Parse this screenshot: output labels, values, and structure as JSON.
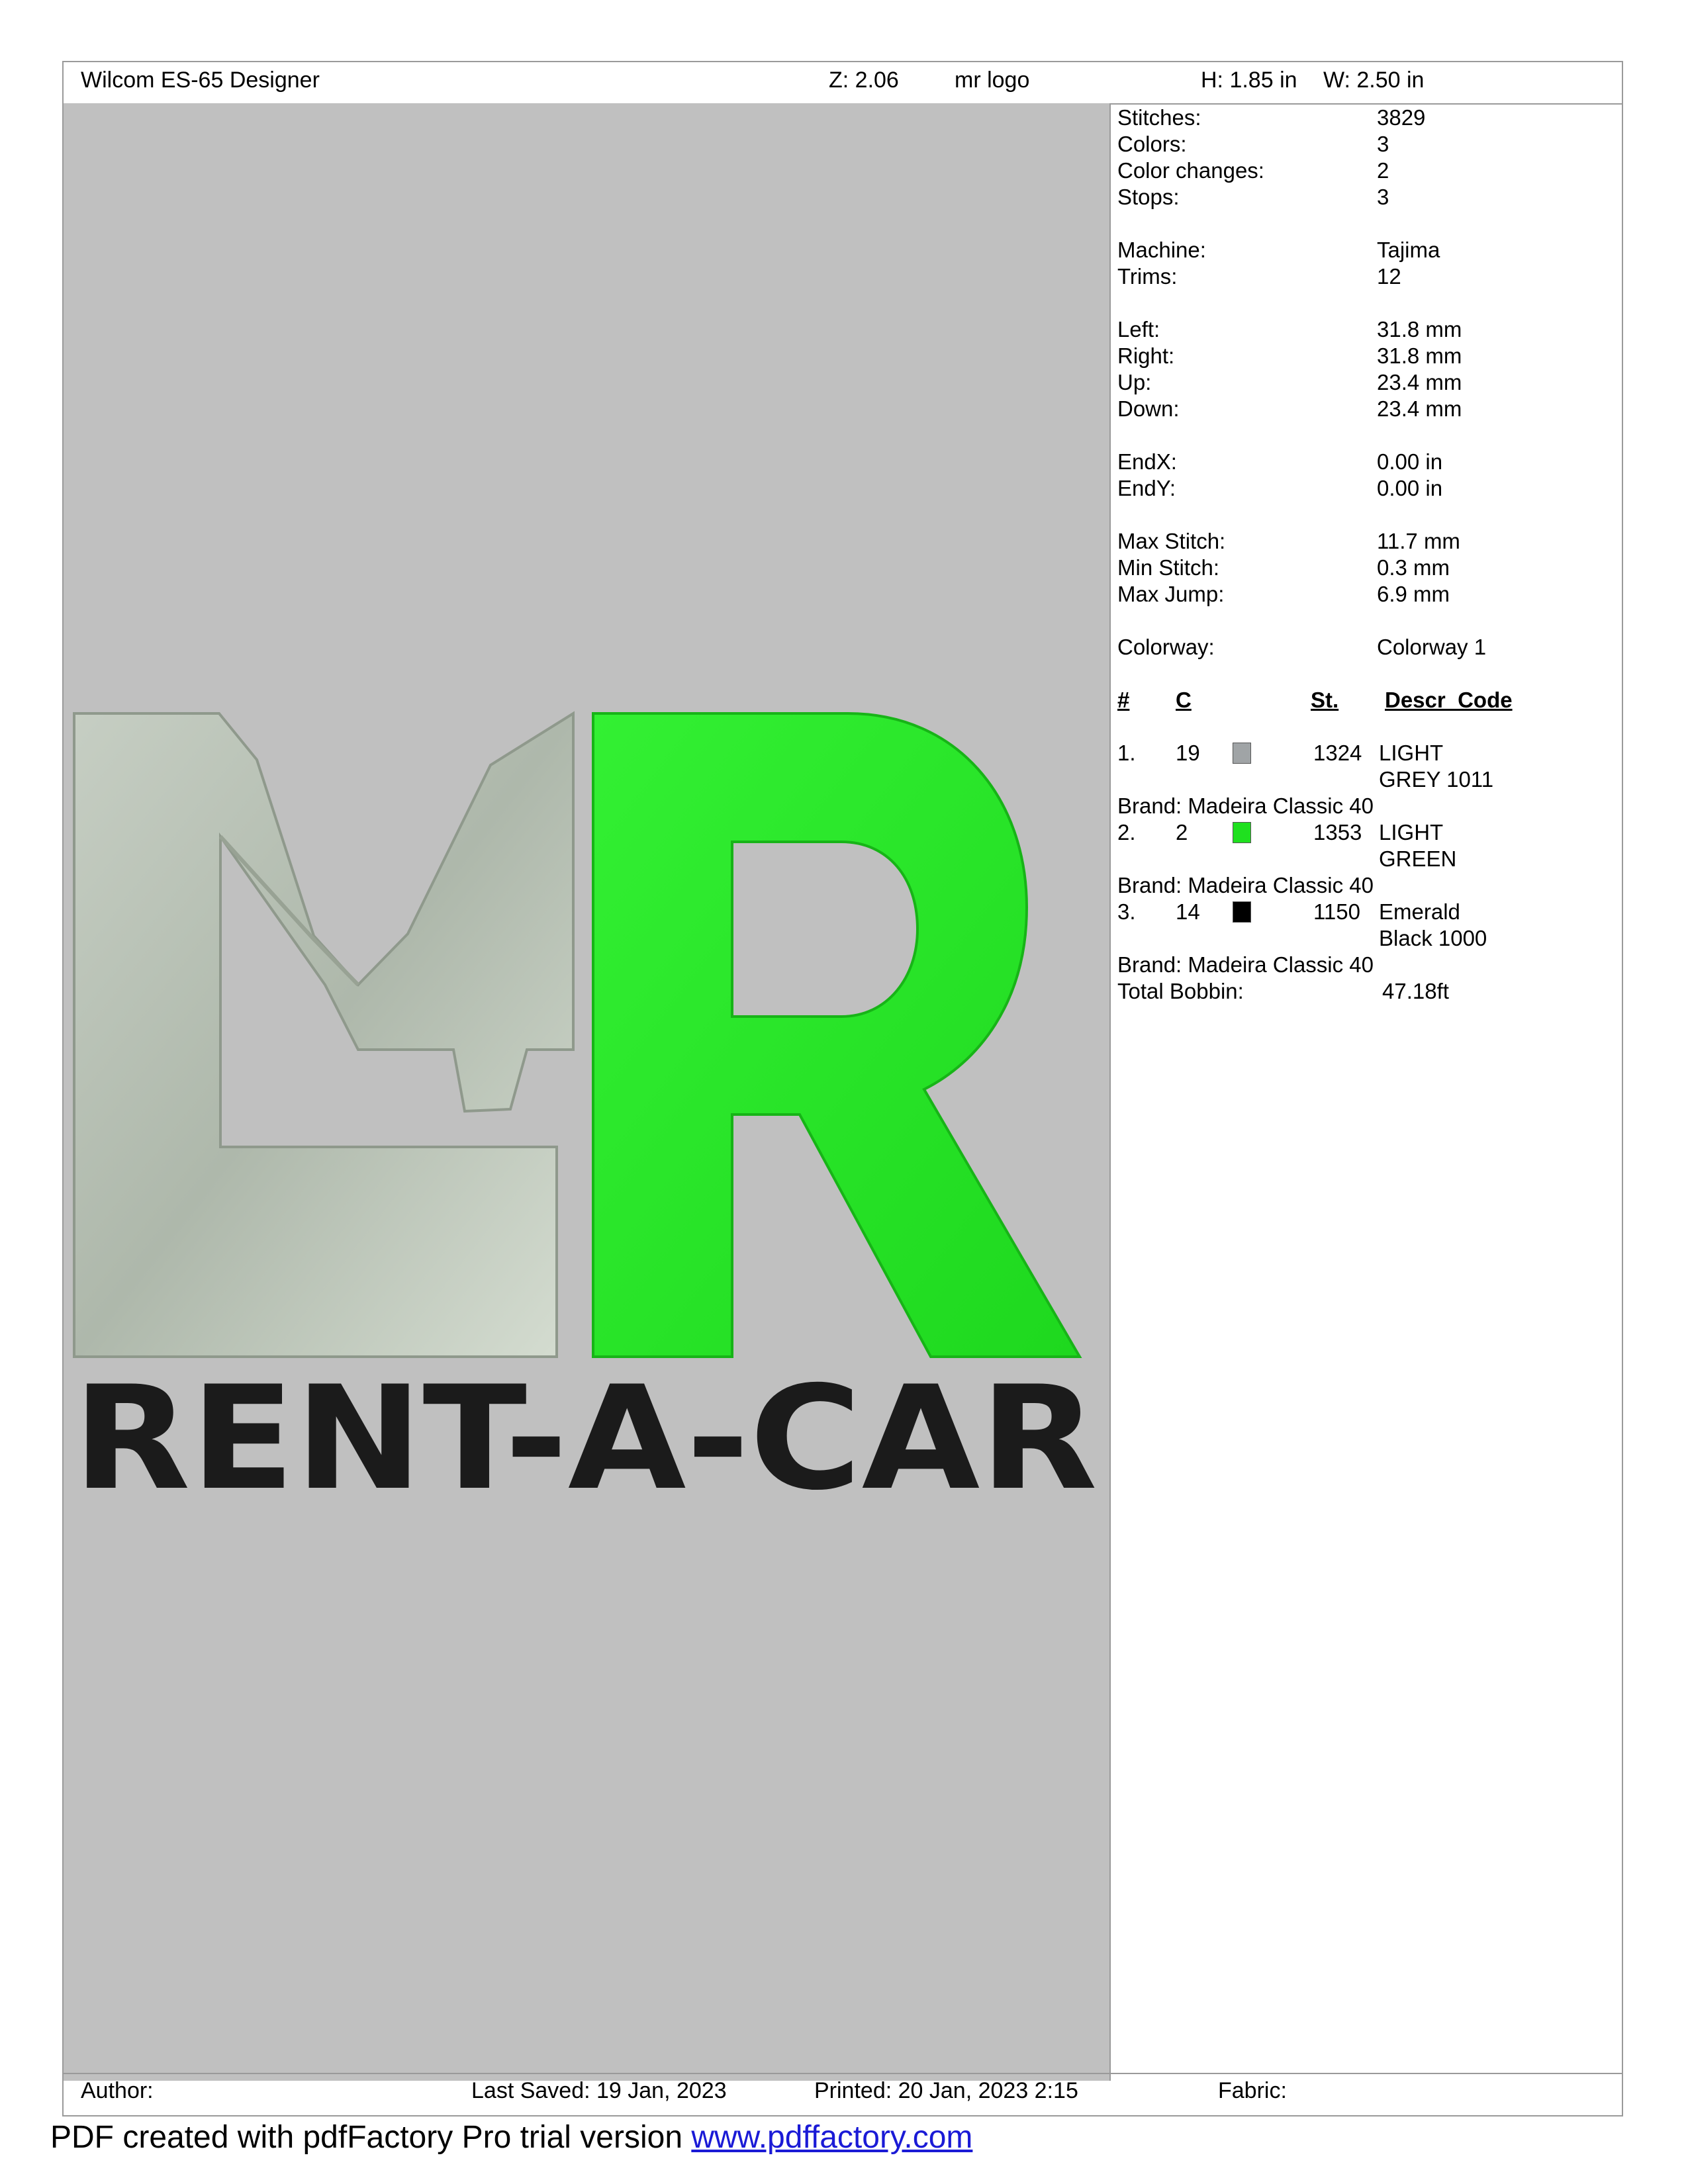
{
  "header": {
    "app": "Wilcom ES-65 Designer",
    "zoom": "Z: 2.06",
    "design_name": "mr logo",
    "height": "H: 1.85 in",
    "width": "W: 2.50 in"
  },
  "design": {
    "logo_bottom_text": "RENT-A-CAR",
    "colors": {
      "grey": "#b9c7b6",
      "green": "#25e825",
      "black": "#1b1b1b",
      "background": "#c0c0c0"
    }
  },
  "info": {
    "stats": [
      {
        "label": "Stitches:",
        "value": "3829"
      },
      {
        "label": "Colors:",
        "value": "3"
      },
      {
        "label": "Color changes:",
        "value": "2"
      },
      {
        "label": "Stops:",
        "value": "3"
      },
      {
        "label": "Machine:",
        "value": "Tajima"
      },
      {
        "label": "Trims:",
        "value": "12"
      },
      {
        "label": "Left:",
        "value": "31.8 mm"
      },
      {
        "label": "Right:",
        "value": "31.8 mm"
      },
      {
        "label": "Up:",
        "value": "23.4 mm"
      },
      {
        "label": "Down:",
        "value": "23.4 mm"
      },
      {
        "label": "EndX:",
        "value": "0.00 in"
      },
      {
        "label": "EndY:",
        "value": "0.00 in"
      },
      {
        "label": "Max Stitch:",
        "value": "11.7 mm"
      },
      {
        "label": "Min Stitch:",
        "value": "0.3 mm"
      },
      {
        "label": "Max Jump:",
        "value": "6.9 mm"
      },
      {
        "label": "Colorway:",
        "value": "Colorway 1"
      }
    ],
    "table_headers": {
      "num": "#",
      "color": "C",
      "stitches": "St.",
      "descr": "Descr_Code"
    },
    "threads": [
      {
        "num": "1.",
        "code": "19",
        "swatch": "#a0a4a6",
        "stitches": "1324",
        "descr1": "LIGHT",
        "descr2": "GREY 1011",
        "brand": "Brand: Madeira Classic 40"
      },
      {
        "num": "2.",
        "code": "2",
        "swatch": "#1fe01f",
        "stitches": "1353",
        "descr1": "LIGHT",
        "descr2": "GREEN",
        "brand": "Brand: Madeira Classic 40"
      },
      {
        "num": "3.",
        "code": "14",
        "swatch": "#000000",
        "stitches": "1150",
        "descr1": "Emerald",
        "descr2": "Black 1000",
        "brand": "Brand: Madeira Classic 40"
      }
    ],
    "total_bobbin_label": "Total Bobbin:",
    "total_bobbin_value": "47.18ft"
  },
  "footer": {
    "author": "Author:",
    "last_saved": "Last Saved: 19 Jan, 2023",
    "printed": "Printed: 20 Jan, 2023  2:15",
    "fabric": "Fabric:"
  },
  "pdf_note": {
    "text": "PDF created with pdfFactory Pro trial version ",
    "link": "www.pdffactory.com"
  }
}
